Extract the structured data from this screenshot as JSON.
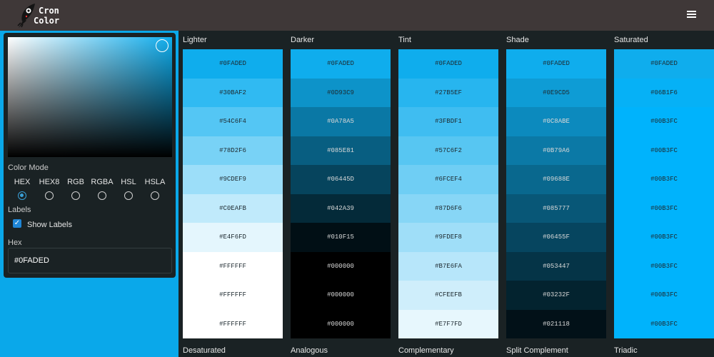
{
  "header": {
    "logo_line1": "Cron",
    "logo_line2": "Color",
    "menu_icon": "hamburger-menu-icon"
  },
  "picker": {
    "color_mode_label": "Color Mode",
    "modes": [
      "HEX",
      "HEX8",
      "RGB",
      "RGBA",
      "HSL",
      "HSLA"
    ],
    "selected_mode": "HEX",
    "labels_section": "Labels",
    "show_labels_label": "Show Labels",
    "show_labels_checked": true,
    "hex_label": "Hex",
    "hex_value": "#0FADED"
  },
  "palettes": [
    {
      "title": "Lighter",
      "swatches": [
        "#0FADED",
        "#30BAF2",
        "#54C6F4",
        "#78D2F6",
        "#9CDEF9",
        "#C0EAFB",
        "#E4F6FD",
        "#FFFFFF",
        "#FFFFFF",
        "#FFFFFF"
      ]
    },
    {
      "title": "Darker",
      "swatches": [
        "#0FADED",
        "#0D93C9",
        "#0A78A5",
        "#085E81",
        "#06445D",
        "#042A39",
        "#010F15",
        "#000000",
        "#000000",
        "#000000"
      ]
    },
    {
      "title": "Tint",
      "swatches": [
        "#0FADED",
        "#27B5EF",
        "#3FBDF1",
        "#57C6F2",
        "#6FCEF4",
        "#87D6F6",
        "#9FDEF8",
        "#B7E6FA",
        "#CFEEFB",
        "#E7F7FD"
      ]
    },
    {
      "title": "Shade",
      "swatches": [
        "#0FADED",
        "#0E9CD5",
        "#0C8ABE",
        "#0B79A6",
        "#09688E",
        "#085777",
        "#06455F",
        "#053447",
        "#03232F",
        "#021118"
      ]
    },
    {
      "title": "Saturated",
      "swatches": [
        "#0FADED",
        "#06B1F6",
        "#00B3FC",
        "#00B3FC",
        "#00B3FC",
        "#00B3FC",
        "#00B3FC",
        "#00B3FC",
        "#00B3FC",
        "#00B3FC"
      ]
    }
  ],
  "bottom_titles": [
    "Desaturated",
    "Analogous",
    "Complementary",
    "Split Complement",
    "Triadic"
  ]
}
